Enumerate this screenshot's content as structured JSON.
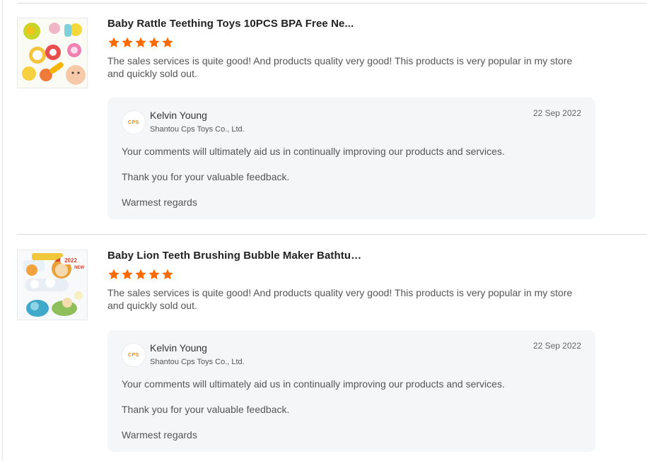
{
  "reviews": [
    {
      "product_title": "Baby Rattle Teething Toys 10PCS BPA Free Ne...",
      "rating": 5,
      "text": "The sales services is quite good! And products quality very good! This products is very popular in my store and quickly sold out.",
      "reply": {
        "avatar_text": "CPS",
        "author": "Kelvin Young",
        "company": "Shantou Cps Toys Co., Ltd.",
        "date": "22 Sep 2022",
        "lines": [
          "Your comments will ultimately aid us in continually improving our products and services.",
          "Thank you for your valuable feedback.",
          "Warmest regards"
        ]
      }
    },
    {
      "product_title": "Baby Lion Teeth Brushing Bubble Maker Bathtub Bath ...",
      "rating": 5,
      "text": "The sales services is quite good! And products quality very good! This products is very popular in my store and quickly sold out.",
      "badge_text": "2022",
      "new_text": "NEW",
      "reply": {
        "avatar_text": "CPS",
        "author": "Kelvin Young",
        "company": "Shantou Cps Toys Co., Ltd.",
        "date": "22 Sep 2022",
        "lines": [
          "Your comments will ultimately aid us in continually improving our products and services.",
          "Thank you for your valuable feedback.",
          "Warmest regards"
        ]
      }
    }
  ],
  "colors": {
    "star": "#ff6a00",
    "reply_bg": "#f5f6f8",
    "divider": "#d9d9d9"
  }
}
